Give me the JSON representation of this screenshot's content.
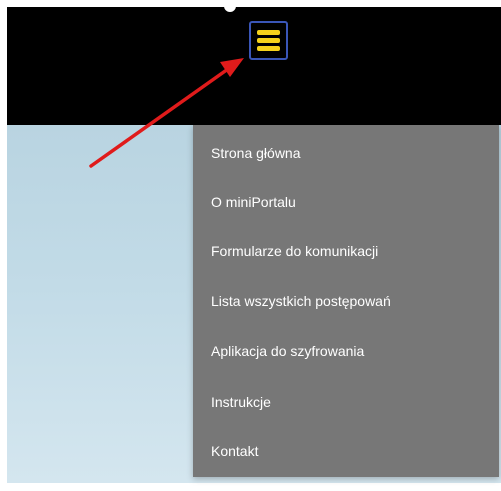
{
  "header": {
    "menu_icon": "hamburger-icon",
    "menu_icon_color": "#f5d21b",
    "menu_button_border": "#3a56b8"
  },
  "annotation": {
    "arrow_color": "#e01b1b"
  },
  "menu": {
    "background": "#777777",
    "items": [
      {
        "label": "Strona główna"
      },
      {
        "label": "O miniPortalu"
      },
      {
        "label": "Formularze do komunikacji"
      },
      {
        "label": "Lista wszystkich postępowań"
      },
      {
        "label": "Aplikacja do szyfrowania"
      },
      {
        "label": "Instrukcje"
      },
      {
        "label": "Kontakt"
      }
    ]
  }
}
